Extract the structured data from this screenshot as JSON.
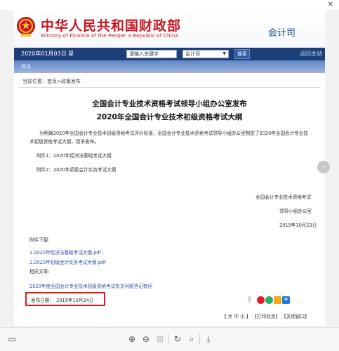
{
  "header": {
    "ministry_cn": "中华人民共和国财政部",
    "ministry_en": "Ministry of Finance of the People' s Republic of China",
    "department": "会计司"
  },
  "navbar": {
    "date": "2020年01月03日  星",
    "search_placeholder": "请输入关键字",
    "search_scope": "会计司",
    "search_button": "搜索",
    "home_link": "返回主站"
  },
  "banner": {
    "label": "简讯"
  },
  "breadcrumb": {
    "prefix": "当前位置：",
    "items": [
      "首页",
      "政策发布"
    ],
    "separator": ">"
  },
  "article": {
    "title_line1": "全国会计专业技术资格考试领导小组办公室发布",
    "title_line2": "2020年全国会计专业技术初级资格考试大纲",
    "body": "为明确2020年全国会计专业技术初级资格考试评价标准，全国会计专业技术资格考试领导小组办公室制定了2020年全国会计专业技术初级资格考试大纲，现予发布。",
    "attachment1": "附件1：2020年经济法基础考试大纲",
    "attachment2": "附件2：2020年初级会计实务考试大纲",
    "signature_line1": "全国会计专业技术资格考试",
    "signature_line2": "领导小组办公室",
    "signature_date": "2019年10月23日",
    "downloads_heading": "附件下载:",
    "downloads": [
      "1.2020年经济法基础考试大纲.pdf",
      "2.2020年初级会计实务考试大纲.pdf"
    ],
    "related_heading": "相关文章:",
    "related_link": "2020年度全国会计专业技术初级资格考试有关问题答记者问",
    "publish_label": "发布日期:",
    "publish_date": "2019年10月24日"
  },
  "footer_links": {
    "font_size": "【 大 中 小 】",
    "print": "【打印此页】",
    "close": "【关闭窗口】"
  },
  "share_icons": [
    "link-icon",
    "weibo-icon",
    "wechat-icon",
    "qzone-icon",
    "more-share-icon"
  ],
  "toolbar_icons": [
    "sidebar-icon",
    "zoom-in-icon",
    "zoom-out-icon",
    "fit-page-icon",
    "rotate-icon",
    "search-icon",
    "download-icon"
  ]
}
